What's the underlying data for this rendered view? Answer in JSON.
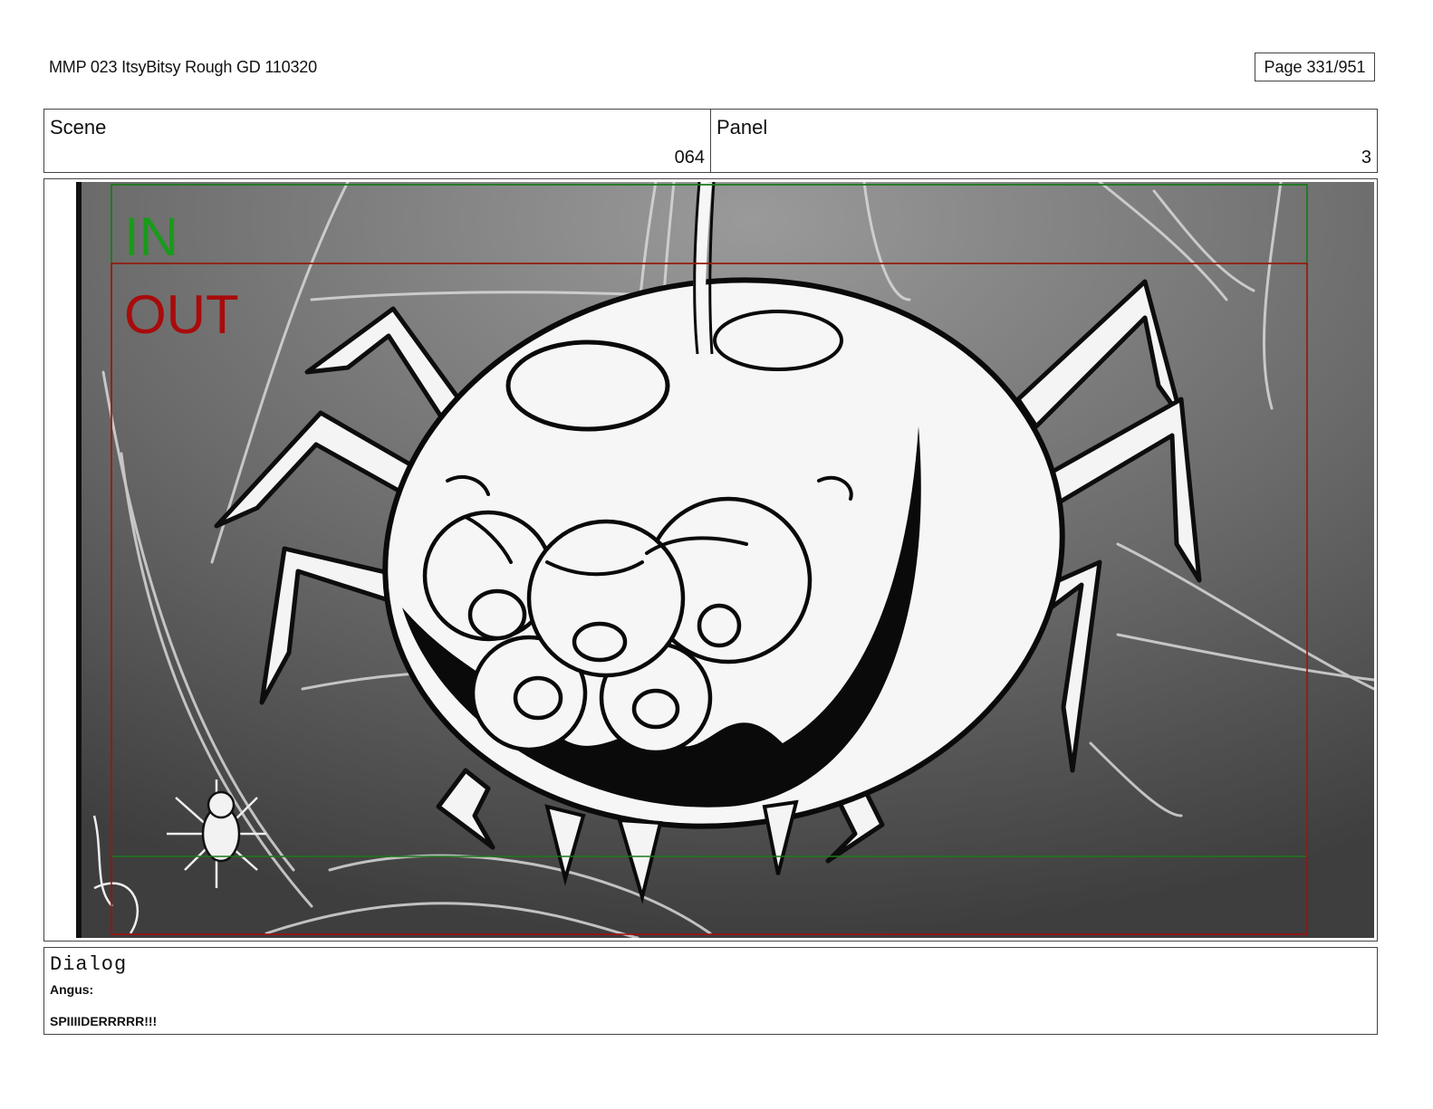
{
  "header": {
    "doc_title": "MMP 023 ItsyBitsy Rough GD 110320",
    "page": "Page 331/951"
  },
  "scene": {
    "label": "Scene",
    "value": "064"
  },
  "panel": {
    "label": "Panel",
    "value": "3"
  },
  "frame": {
    "in_label": "IN",
    "out_label": "OUT",
    "colors": {
      "in": "#1a9a1a",
      "out": "#a80b0b"
    }
  },
  "dialog": {
    "title": "Dialog",
    "speaker": "Angus:",
    "line": "SPIIIIDERRRRR!!!"
  }
}
